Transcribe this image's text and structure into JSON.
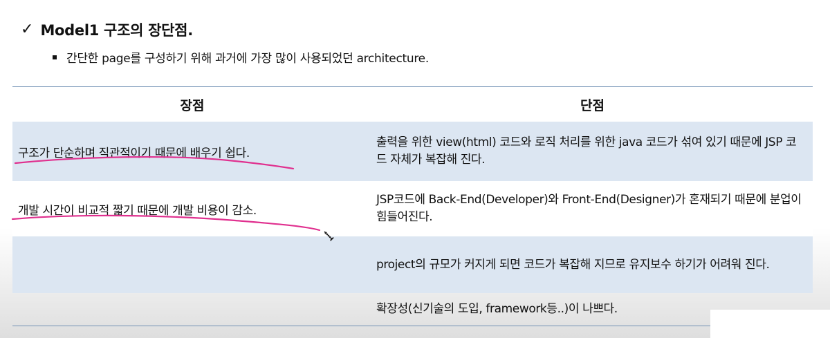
{
  "heading": {
    "check_icon": "check-mark-icon",
    "title": "Model1 구조의 장단점."
  },
  "bullet": {
    "text": "간단한 page를 구성하기 위해 과거에 가장 많이 사용되었던 architecture."
  },
  "table": {
    "headers": {
      "pros": "장점",
      "cons": "단점"
    },
    "rows": [
      {
        "pro": "구조가 단순하며 직관적이기 때문에 배우기 쉽다.",
        "con": "출력을 위한 view(html) 코드와 로직 처리를 위한 java 코드가 섞여 있기 때문에 JSP 코드 자체가 복잡해 진다."
      },
      {
        "pro": "개발 시간이 비교적 짧기 때문에 개발 비용이 감소.",
        "con": "JSP코드에 Back-End(Developer)와 Front-End(Designer)가 혼재되기 때문에 분업이 힘들어진다."
      },
      {
        "pro": "",
        "con": "project의 규모가 커지게 되면 코드가 복잡해 지므로 유지보수 하기가 어려워 진다."
      },
      {
        "pro": "",
        "con": "확장성(신기술의 도입, framework등..)이 나쁘다."
      }
    ]
  },
  "annotation": {
    "pen_color": "#e0308f",
    "cursor_icon": "pen-cursor-icon"
  }
}
